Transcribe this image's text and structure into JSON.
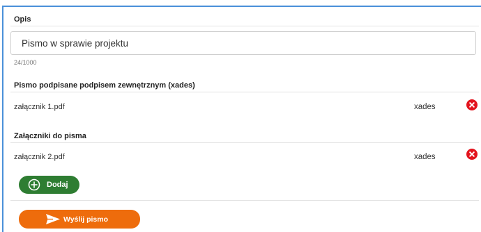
{
  "description": {
    "label": "Opis",
    "value": "Pismo w sprawie projektu",
    "counter": "24/1000"
  },
  "signed_section": {
    "label": "Pismo podpisane podpisem zewnętrznym (xades)",
    "files": [
      {
        "name": "załącznik 1.pdf",
        "type": "xades"
      }
    ]
  },
  "attachments_section": {
    "label": "Załączniki do pisma",
    "files": [
      {
        "name": "załącznik 2.pdf",
        "type": "xades"
      }
    ]
  },
  "buttons": {
    "add_label": "Dodaj",
    "send_label": "Wyślij pismo"
  },
  "colors": {
    "accent_border": "#4a90d9",
    "add_button": "#2e7d32",
    "send_button": "#ee6c0c",
    "remove_icon": "#e3141e"
  },
  "icons": {
    "remove": "close-circle-icon",
    "add": "plus-circle-icon",
    "send": "paper-plane-icon"
  }
}
